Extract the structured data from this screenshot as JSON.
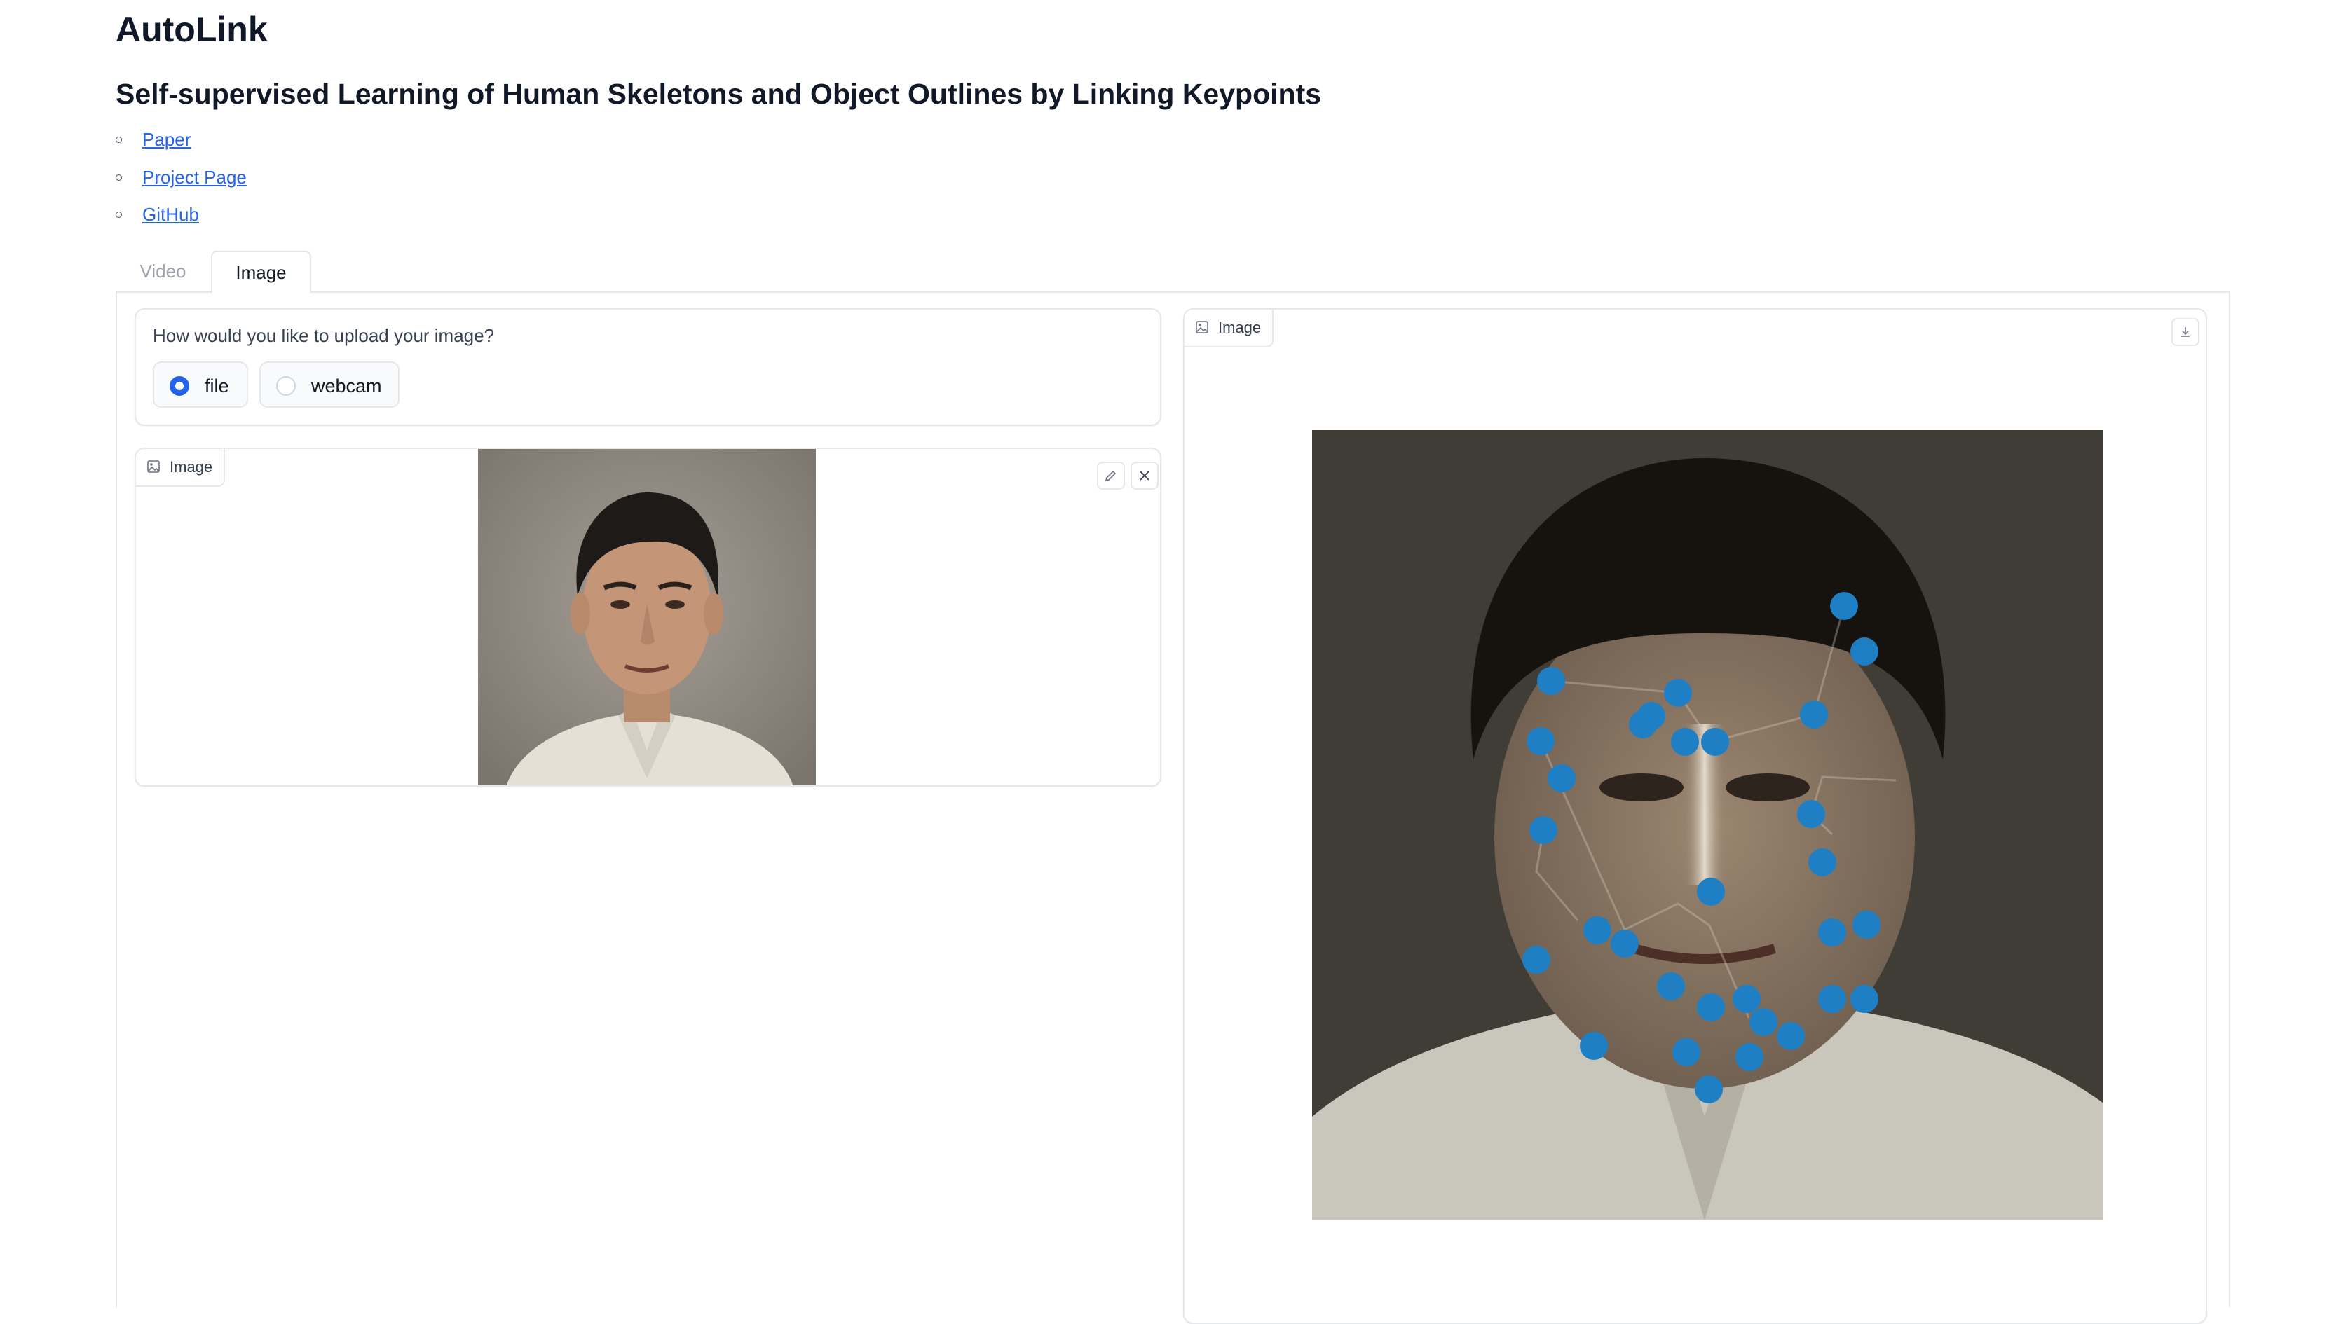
{
  "header": {
    "title": "AutoLink",
    "subtitle": "Self-supervised Learning of Human Skeletons and Object Outlines by Linking Keypoints"
  },
  "links": [
    {
      "label": "Paper"
    },
    {
      "label": "Project Page"
    },
    {
      "label": "GitHub"
    }
  ],
  "tabs": [
    {
      "label": "Video",
      "selected": false
    },
    {
      "label": "Image",
      "selected": true
    }
  ],
  "upload_mode": {
    "question": "How would you like to upload your image?",
    "options": [
      {
        "label": "file",
        "checked": true
      },
      {
        "label": "webcam",
        "checked": false
      }
    ]
  },
  "input_image": {
    "badge_label": "Image",
    "badge_icon": "image-icon",
    "tools": [
      "edit-icon",
      "close-icon"
    ]
  },
  "output_image": {
    "badge_label": "Image",
    "badge_icon": "image-icon",
    "tools": [
      "download-icon"
    ],
    "keypoint_color": "#1f7fc4"
  },
  "colors": {
    "accent": "#2563eb",
    "link": "#2563eb",
    "border": "#e5e7eb",
    "keypoint": "#1f7fc4"
  }
}
